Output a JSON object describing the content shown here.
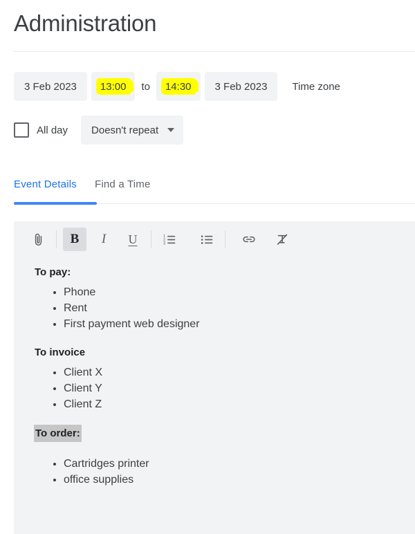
{
  "header": {
    "title": "Administration"
  },
  "schedule": {
    "start_date": "3 Feb 2023",
    "start_time": "13:00",
    "separator": "to",
    "end_time": "14:30",
    "end_date": "3 Feb 2023",
    "timezone_label": "Time zone",
    "highlight_color": "#ffff00",
    "all_day_label": "All day",
    "all_day_checked": false,
    "recurrence_value": "Doesn't repeat"
  },
  "tabs": {
    "active_index": 0,
    "accent_color": "#1a73e8",
    "items": [
      {
        "label": "Event Details"
      },
      {
        "label": "Find a Time"
      }
    ]
  },
  "editor": {
    "toolbar": [
      {
        "name": "attach-icon",
        "title": "Attach file",
        "active": false
      },
      {
        "name": "bold-icon",
        "title": "Bold",
        "glyph": "B",
        "active": true
      },
      {
        "name": "italic-icon",
        "title": "Italic",
        "glyph": "I",
        "active": false
      },
      {
        "name": "underline-icon",
        "title": "Underline",
        "glyph": "U",
        "active": false
      },
      {
        "name": "numbered-list-icon",
        "title": "Numbered list",
        "active": false
      },
      {
        "name": "bulleted-list-icon",
        "title": "Bulleted list",
        "active": false
      },
      {
        "name": "link-icon",
        "title": "Insert link",
        "active": false
      },
      {
        "name": "clear-formatting-icon",
        "title": "Remove formatting",
        "active": false
      }
    ],
    "selection_color": "#c6c6c6",
    "blocks": [
      {
        "heading": "To pay:",
        "selected": false,
        "items": [
          "Phone",
          "Rent",
          "First payment web designer"
        ]
      },
      {
        "heading": "To invoice",
        "selected": false,
        "items": [
          "Client X",
          "Client Y",
          "Client Z"
        ]
      },
      {
        "heading": "To order:",
        "selected": true,
        "items": [
          "Cartridges printer",
          "office supplies"
        ]
      }
    ]
  }
}
